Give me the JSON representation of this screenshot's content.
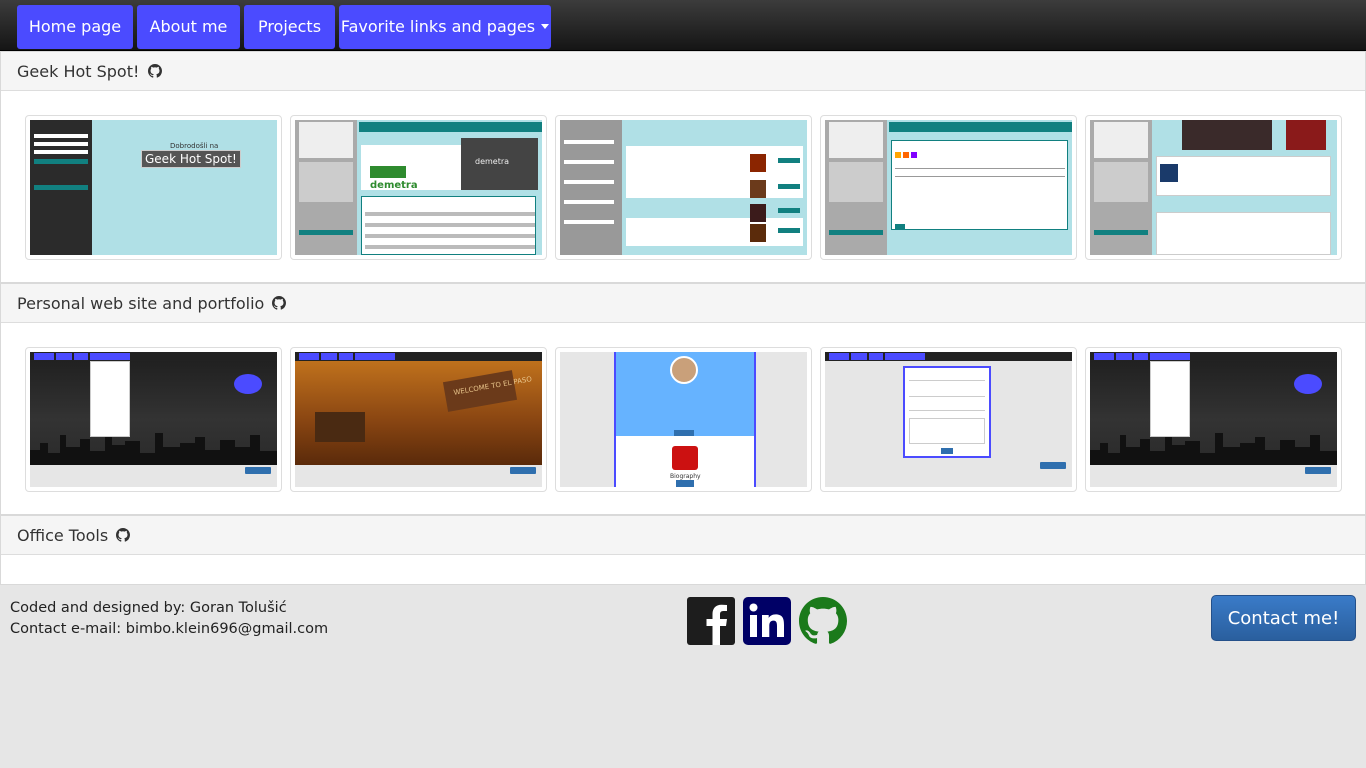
{
  "nav": {
    "items": [
      {
        "label": "Home page"
      },
      {
        "label": "About me"
      },
      {
        "label": "Projects"
      },
      {
        "label": "Favorite links and pages"
      }
    ],
    "accent": "#4b4bff"
  },
  "sections": [
    {
      "title": "Geek Hot Spot!",
      "thumbnail_banner": "Geek Hot Spot!",
      "thumbnail_welcome": "Dobrodošli na",
      "thumbnail_brand": "demetra"
    },
    {
      "title": "Personal web site and portfolio",
      "thumbnail_sign": "WELCOME TO EL PASO",
      "thumbnail_biography": "Biography"
    },
    {
      "title": "Office Tools"
    }
  ],
  "footer": {
    "credits": "Coded and designed by: Goran Tolušić",
    "email": "Contact e-mail: bimbo.klein696@gmail.com",
    "contact_label": "Contact me!",
    "social": [
      "facebook-icon",
      "linkedin-icon",
      "github-icon"
    ]
  }
}
